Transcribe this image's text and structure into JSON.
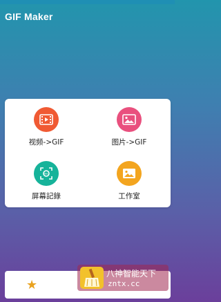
{
  "app": {
    "title": "GIF Maker"
  },
  "menu": {
    "items": [
      {
        "label": "视频->GIF",
        "icon": "video-film-icon",
        "color": "#f05a33"
      },
      {
        "label": "图片->GIF",
        "icon": "picture-icon",
        "color": "#e9507e"
      },
      {
        "label": "屏幕記錄",
        "icon": "screen-record-icon",
        "color": "#16b39a"
      },
      {
        "label": "工作室",
        "icon": "gallery-icon",
        "color": "#f3a51f"
      }
    ]
  },
  "bottom_bar": {
    "icon": "star-icon",
    "star_color": "#e9a21f"
  },
  "watermark": {
    "line1": "八神智能天下",
    "line2": "zntx.cc"
  }
}
